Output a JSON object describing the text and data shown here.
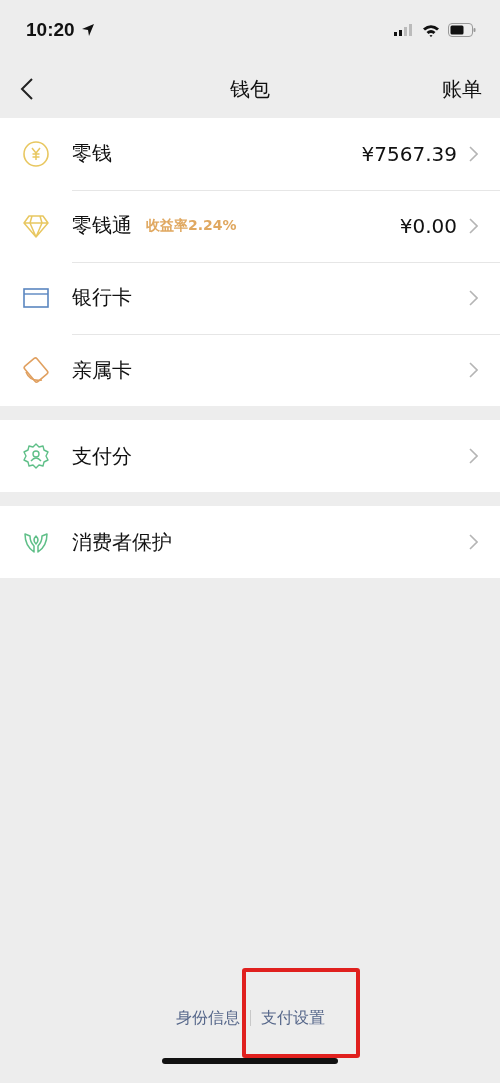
{
  "status_bar": {
    "time": "10:20"
  },
  "nav": {
    "title": "钱包",
    "action": "账单"
  },
  "groups": [
    {
      "items": [
        {
          "kind": "coin",
          "label": "零钱",
          "value": "¥7567.39"
        },
        {
          "kind": "diamond",
          "label": "零钱通",
          "tag": "收益率2.24%",
          "value": "¥0.00"
        },
        {
          "kind": "card",
          "label": "银行卡"
        },
        {
          "kind": "family",
          "label": "亲属卡"
        }
      ]
    },
    {
      "items": [
        {
          "kind": "score",
          "label": "支付分"
        }
      ]
    },
    {
      "items": [
        {
          "kind": "hands",
          "label": "消费者保护"
        }
      ]
    }
  ],
  "footer_links": [
    {
      "label": "身份信息",
      "highlighted": false
    },
    {
      "label": "支付设置",
      "highlighted": true
    }
  ]
}
